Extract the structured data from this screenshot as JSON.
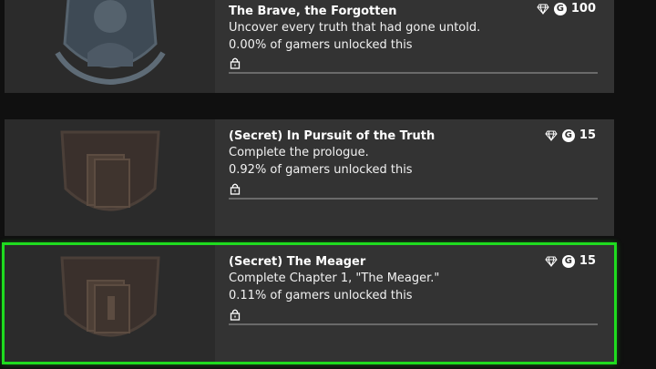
{
  "achievements": [
    {
      "title": "The Brave, the Forgotten",
      "description": "Uncover every truth that had gone untold.",
      "unlock_rate": "0.00% of gamers unlocked this",
      "gamerscore": "100",
      "gamerscore_badge": "G",
      "locked": true,
      "progress": 0,
      "art_icon": "knight-emblem-icon"
    },
    {
      "title": "(Secret) In Pursuit of the Truth",
      "description": "Complete the prologue.",
      "unlock_rate": "0.92% of gamers unlocked this",
      "gamerscore": "15",
      "gamerscore_badge": "G",
      "locked": true,
      "progress": 0,
      "art_icon": "book-emblem-icon"
    },
    {
      "title": "(Secret) The Meager",
      "description": "Complete Chapter 1, \"The Meager.\"",
      "unlock_rate": "0.11% of gamers unlocked this",
      "gamerscore": "15",
      "gamerscore_badge": "G",
      "locked": true,
      "progress": 0,
      "art_icon": "book-chapter-emblem-icon",
      "selected": true
    }
  ],
  "colors": {
    "selection_outline": "#1fdc1f",
    "card_background": "#333333",
    "progress_track": "#6a6a6a"
  }
}
